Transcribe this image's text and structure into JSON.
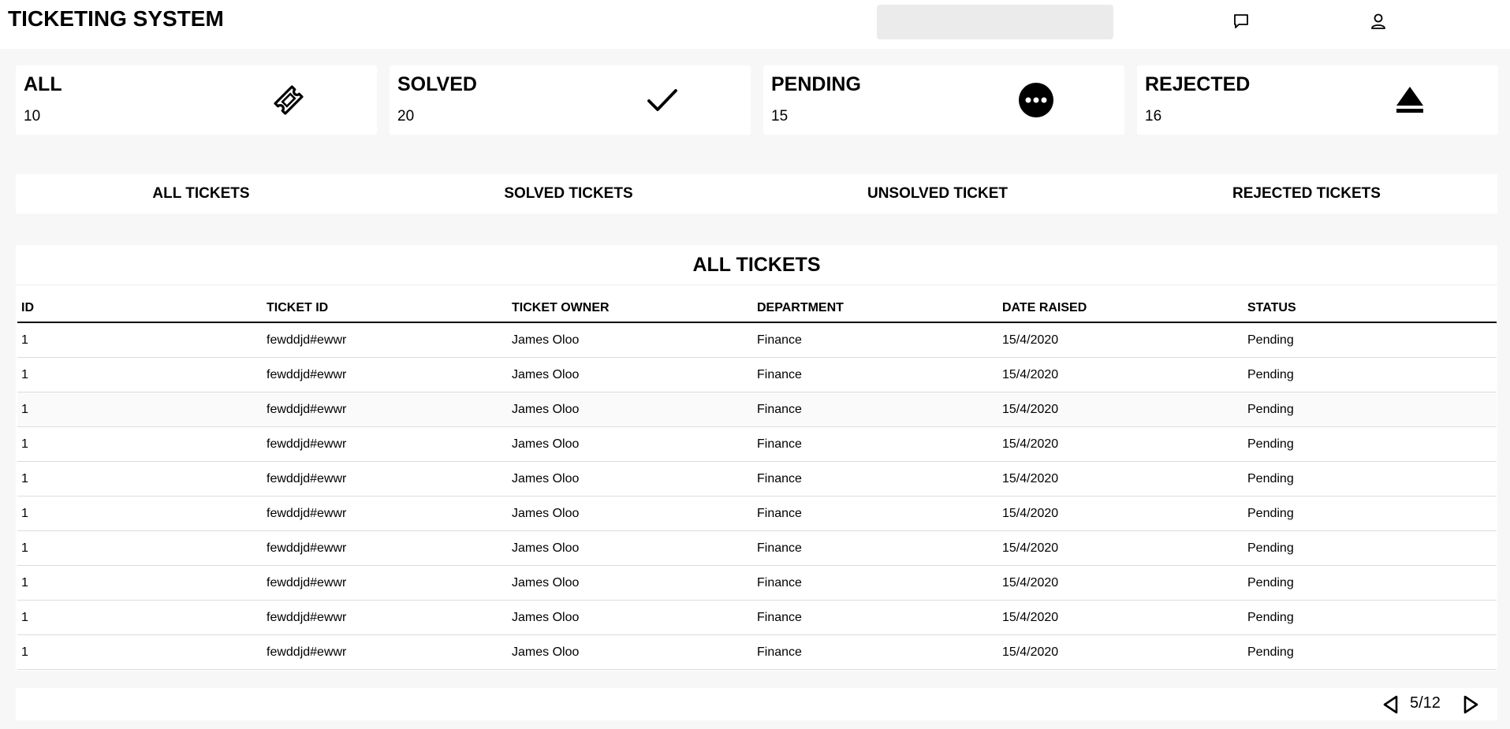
{
  "header": {
    "title": "TICKETING SYSTEM",
    "search_placeholder": "",
    "icons": [
      "chat-icon",
      "user-icon"
    ]
  },
  "stats": [
    {
      "label": "ALL",
      "value": "10",
      "icon": "ticket-icon"
    },
    {
      "label": "SOLVED",
      "value": "20",
      "icon": "checkmark-icon"
    },
    {
      "label": "PENDING",
      "value": "15",
      "icon": "more-dots-icon"
    },
    {
      "label": "REJECTED",
      "value": "16",
      "icon": "eject-icon"
    }
  ],
  "tabs": [
    "ALL TICKETS",
    "SOLVED TICKETS",
    "UNSOLVED TICKET",
    "REJECTED TICKETS"
  ],
  "table": {
    "title": "ALL TICKETS",
    "columns": [
      "ID",
      "TICKET ID",
      "TICKET OWNER",
      "DEPARTMENT",
      "DATE RAISED",
      "STATUS"
    ],
    "rows": [
      [
        "1",
        "fewddjd#ewwr",
        "James Oloo",
        "Finance",
        "15/4/2020",
        "Pending"
      ],
      [
        "1",
        "fewddjd#ewwr",
        "James Oloo",
        "Finance",
        "15/4/2020",
        "Pending"
      ],
      [
        "1",
        "fewddjd#ewwr",
        "James Oloo",
        "Finance",
        "15/4/2020",
        "Pending"
      ],
      [
        "1",
        "fewddjd#ewwr",
        "James Oloo",
        "Finance",
        "15/4/2020",
        "Pending"
      ],
      [
        "1",
        "fewddjd#ewwr",
        "James Oloo",
        "Finance",
        "15/4/2020",
        "Pending"
      ],
      [
        "1",
        "fewddjd#ewwr",
        "James Oloo",
        "Finance",
        "15/4/2020",
        "Pending"
      ],
      [
        "1",
        "fewddjd#ewwr",
        "James Oloo",
        "Finance",
        "15/4/2020",
        "Pending"
      ],
      [
        "1",
        "fewddjd#ewwr",
        "James Oloo",
        "Finance",
        "15/4/2020",
        "Pending"
      ],
      [
        "1",
        "fewddjd#ewwr",
        "James Oloo",
        "Finance",
        "15/4/2020",
        "Pending"
      ],
      [
        "1",
        "fewddjd#ewwr",
        "James Oloo",
        "Finance",
        "15/4/2020",
        "Pending"
      ]
    ]
  },
  "pagination": {
    "text": "5/12",
    "icons": [
      "prev-page-icon",
      "next-page-icon"
    ]
  },
  "colors": {
    "page_background": "#f7f7f7",
    "panel_background": "#ffffff",
    "search_background": "#ebebeb"
  }
}
